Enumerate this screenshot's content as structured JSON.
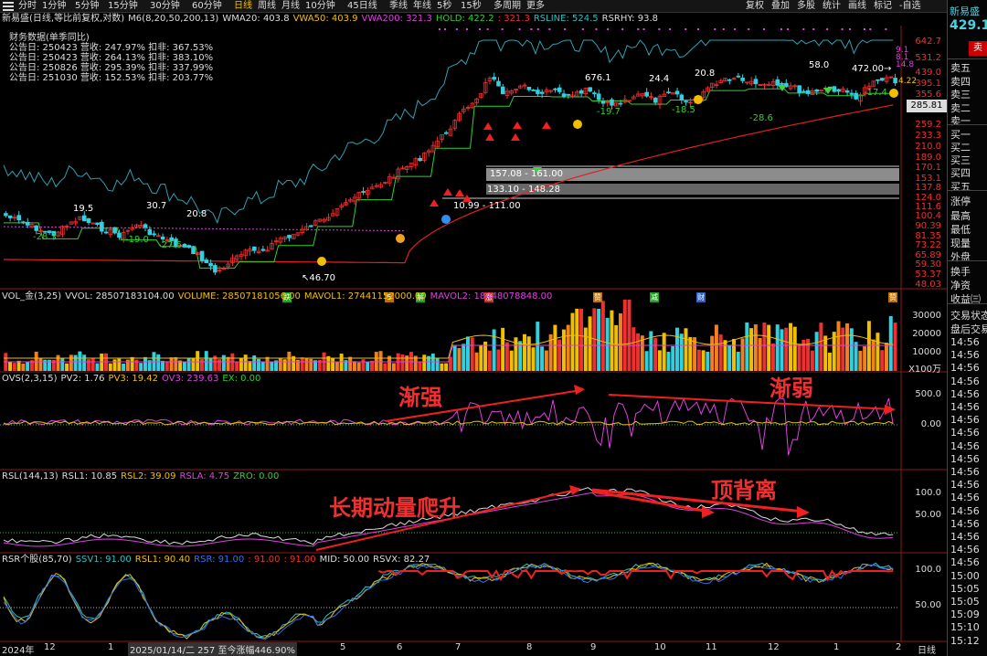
{
  "toolbar": {
    "items": [
      "分时",
      "1分钟",
      "5分钟",
      "15分钟",
      "30分钟",
      "60分钟",
      "日线",
      "周线",
      "月线",
      "10分钟",
      "45日线",
      "季线",
      "年线",
      "5秒",
      "15秒",
      "多周期",
      "更多"
    ],
    "selected": "日线",
    "right_items": [
      "复权",
      "叠加",
      "多股",
      "统计",
      "画线",
      "标记",
      "-自选"
    ]
  },
  "main_legend": {
    "title": "新易盛(日线,等比前复权,对数)",
    "items": [
      {
        "label": "M6(8,20,50,200,13)",
        "color": "#dddddd"
      },
      {
        "label": "WMA20: 403.8",
        "color": "#dddddd"
      },
      {
        "label": "VWA50: 403.9",
        "color": "#f0c000"
      },
      {
        "label": "VWA200: 321.3",
        "color": "#e040e0"
      },
      {
        "label": "HOLD: 422.2",
        "color": "#30d030"
      },
      {
        "label": ": 321.3",
        "color": "#f03030"
      },
      {
        "label": "RSLINE: 524.5",
        "color": "#30c0c0"
      },
      {
        "label": "RSRHY: 93.8",
        "color": "#dddddd"
      }
    ]
  },
  "finance": {
    "title": "财务数据(单季同比)",
    "rows": [
      "公告日: 250423   营收: 247.97%   扣非: 367.53%",
      "公告日: 250423   营收: 264.13%   扣非: 383.10%",
      "公告日: 250826   营收: 295.39%   扣非: 337.99%",
      "公告日: 251030   营收: 152.53%   扣非: 203.77%"
    ]
  },
  "price_axis": [
    "642.7",
    "531.2",
    "439.0",
    "395.1",
    "355.6",
    "320.0",
    "285.81",
    "259.2",
    "233.3",
    "210.0",
    "189.0",
    "170.1",
    "153.1",
    "137.8",
    "124.0",
    "111.6",
    "100.4",
    "90.39",
    "81.35",
    "73.22",
    "65.89",
    "59.30",
    "53.37",
    "48.03"
  ],
  "current_price_label": "285.81",
  "price_annotations": {
    "low": "46.70",
    "high1": "676.1",
    "hi2": "24.4",
    "hi3": "20.8",
    "hi4": "58.0",
    "hi5": "472.00",
    "hi6": "14.8",
    "lo1": "-28.3",
    "lo2": "-19.0",
    "lo3": "-27.6",
    "lo4": "-19.7",
    "lo5": "-18.5",
    "lo6": "-28.6",
    "lo7": "-17.4",
    "a1": "19.5",
    "a2": "30.7",
    "a3": "20.8",
    "a4": "9.1",
    "a5": "8.1",
    "a6": "4.22"
  },
  "zones": [
    {
      "label": "157.08 - 161.00"
    },
    {
      "label": "133.10 - 148.28"
    },
    {
      "label": "10.99 - 111.00"
    }
  ],
  "events": [
    {
      "label": "跌",
      "color": "#20a020"
    },
    {
      "label": "5",
      "color": "#c07000"
    },
    {
      "label": "解",
      "color": "#20a020"
    },
    {
      "label": "涨",
      "color": "#c03030"
    },
    {
      "label": "赞",
      "color": "#c07000"
    },
    {
      "label": "减",
      "color": "#20a020"
    },
    {
      "label": "财",
      "color": "#3060c0"
    },
    {
      "label": "赞",
      "color": "#c07000"
    }
  ],
  "vol_legend": {
    "items": [
      {
        "label": "VOL_金(3,25)",
        "color": "#dddddd"
      },
      {
        "label": "VVOL: 28507183104.00",
        "color": "#dddddd"
      },
      {
        "label": "VOLUME: 28507181056.00",
        "color": "#f0c000"
      },
      {
        "label": "MAVOL1: 27441152000.00",
        "color": "#f0c000"
      },
      {
        "label": "MAVOL2: 18448078848.00",
        "color": "#e040e0"
      }
    ]
  },
  "vol_axis": [
    "30000",
    "20000",
    "10000",
    "X100万"
  ],
  "ovs_legend": {
    "items": [
      {
        "label": "OVS(2,3,15)",
        "color": "#dddddd"
      },
      {
        "label": "PV2: 1.76",
        "color": "#dddddd"
      },
      {
        "label": "PV3: 19.42",
        "color": "#f0c000"
      },
      {
        "label": "OV3: 239.63",
        "color": "#e040e0"
      },
      {
        "label": "EX: 0.00",
        "color": "#30d030"
      }
    ]
  },
  "ovs_axis": [
    "500.0",
    "0.00"
  ],
  "rsl_legend": {
    "items": [
      {
        "label": "RSL(144,13)",
        "color": "#dddddd"
      },
      {
        "label": "RSL1: 10.85",
        "color": "#dddddd"
      },
      {
        "label": "RSL2: 39.09",
        "color": "#f0c000"
      },
      {
        "label": "RSLA: 4.75",
        "color": "#e040e0"
      },
      {
        "label": "ZRO: 0.00",
        "color": "#30d030"
      }
    ]
  },
  "rsl_axis": [
    "100.0",
    "50.00"
  ],
  "rsr_legend": {
    "items": [
      {
        "label": "RSR个股(85,70)",
        "color": "#dddddd"
      },
      {
        "label": "SSV1: 91.00",
        "color": "#30c0c0"
      },
      {
        "label": "RSL1: 90.40",
        "color": "#f0c000"
      },
      {
        "label": "RSR: 91.00",
        "color": "#3070f0"
      },
      {
        "label": ": 91.00",
        "color": "#f03030"
      },
      {
        "label": ": 91.00",
        "color": "#f03030"
      },
      {
        "label": "MID: 50.00",
        "color": "#dddddd"
      },
      {
        "label": "RSVX: 82.27",
        "color": "#dddddd"
      }
    ]
  },
  "rsr_axis": [
    "100.0",
    "50.00"
  ],
  "annotations": {
    "ovs_left": "渐强",
    "ovs_right": "渐弱",
    "rsl_left": "长期动量爬升",
    "rsl_right": "顶背离"
  },
  "x_axis": {
    "labels": [
      "2024年",
      "12",
      "1",
      "2",
      "3",
      "4",
      "5",
      "6",
      "7",
      "8",
      "9",
      "10",
      "11",
      "12",
      "1",
      "2"
    ],
    "period": "日线",
    "banner": "2025/01/14/二 257 至今涨幅446.90%"
  },
  "right_panel": {
    "name": "新易盛",
    "price": "429.10",
    "sell_btn": "卖",
    "rows": [
      "卖五",
      "卖四",
      "卖三",
      "卖二",
      "卖一",
      "买一",
      "买二",
      "买三",
      "买四",
      "买五",
      "涨停",
      "最高",
      "最低",
      "现量",
      "外盘",
      "换手",
      "净资",
      "收益㈢",
      "交易状态",
      "盘后交易"
    ],
    "times": [
      "14:56",
      "14:56",
      "14:56",
      "14:56",
      "14:56",
      "14:56",
      "14:56",
      "14:56",
      "14:56",
      "14:56",
      "14:56",
      "14:56",
      "14:56",
      "14:56",
      "14:56",
      "14:56",
      "14:56",
      "14:56",
      "15:00",
      "15:05",
      "15:05",
      "15:09",
      "15:10",
      "15:12"
    ]
  },
  "colors": {
    "up": "#f03030",
    "down": "#30d0e0",
    "ma_green": "#30d030",
    "ma_red": "#e02020",
    "rsline": "#30a0b0",
    "magenta": "#e040e0",
    "yellow": "#f0c000",
    "white": "#dddddd",
    "orange": "#f08020"
  },
  "chart_data": [
    {
      "type": "candlestick",
      "title": "新易盛(日线,等比前复权,对数)",
      "series": [
        {
          "name": "HOLD",
          "values": []
        },
        {
          "name": "RSLINE",
          "values": []
        }
      ],
      "ylim": [
        48.03,
        642.7
      ],
      "log_scale": true,
      "x_range": [
        "2024-11",
        "2026-02"
      ],
      "key_points": [
        {
          "label": "low",
          "y": 46.7
        },
        {
          "label": "high",
          "y": 676.1
        },
        {
          "label": "last",
          "y": 429.1
        }
      ]
    },
    {
      "type": "bar",
      "title": "VOL_金(3,25)",
      "ylim": [
        0,
        35000
      ],
      "unit": "X100万",
      "series": [
        {
          "name": "MAVOL1",
          "values": []
        },
        {
          "name": "MAVOL2",
          "values": []
        }
      ]
    },
    {
      "type": "line",
      "title": "OVS(2,3,15)",
      "ylim": [
        -700,
        600
      ]
    },
    {
      "type": "line",
      "title": "RSL(144,13)",
      "ylim": [
        0,
        120
      ]
    },
    {
      "type": "line",
      "title": "RSR个股(85,70)",
      "ylim": [
        0,
        110
      ]
    }
  ]
}
